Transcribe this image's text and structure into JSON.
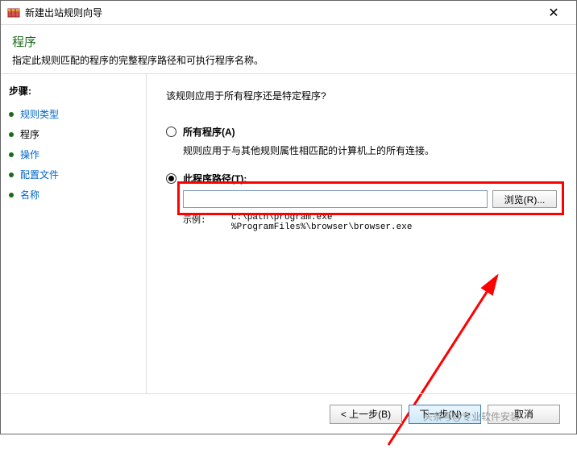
{
  "window": {
    "title": "新建出站规则向导",
    "close_symbol": "✕"
  },
  "header": {
    "title": "程序",
    "subtitle": "指定此规则匹配的程序的完整程序路径和可执行程序名称。"
  },
  "sidebar": {
    "label": "步骤:",
    "steps": [
      {
        "label": "规则类型",
        "state": "link"
      },
      {
        "label": "程序",
        "state": "current"
      },
      {
        "label": "操作",
        "state": "inactive"
      },
      {
        "label": "配置文件",
        "state": "inactive"
      },
      {
        "label": "名称",
        "state": "inactive"
      }
    ]
  },
  "main": {
    "question": "该规则应用于所有程序还是特定程序?",
    "options": {
      "all": {
        "label": "所有程序(A)",
        "desc": "规则应用于与其他规则属性相匹配的计算机上的所有连接。",
        "selected": false
      },
      "path": {
        "label": "此程序路径(T):",
        "selected": true,
        "value": "",
        "browse_label": "浏览(R)..."
      }
    },
    "example": {
      "label": "示例:",
      "paths": "c:\\path\\program.exe\n%ProgramFiles%\\browser\\browser.exe"
    }
  },
  "footer": {
    "back": "< 上一步(B)",
    "next": "下一步(N) >",
    "cancel": "取消"
  },
  "watermark": "头条号@专业软件安装"
}
